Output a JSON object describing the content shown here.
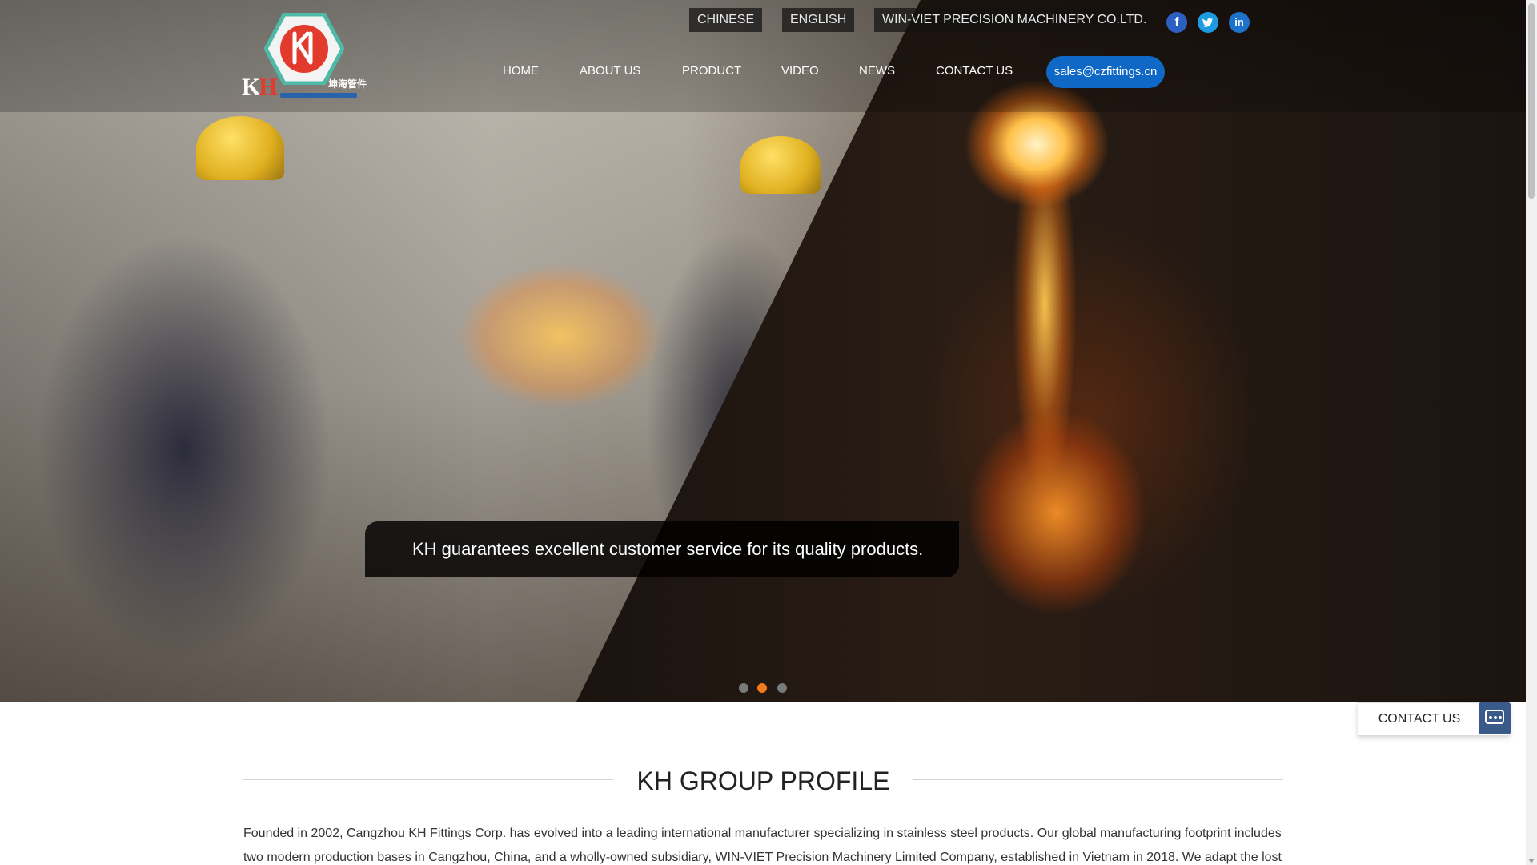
{
  "top_bar": {
    "lang_chinese": "CHINESE",
    "lang_english": "ENGLISH",
    "subsidiary": "WIN-VIET PRECISION MACHINERY CO.LTD."
  },
  "social": {
    "facebook_glyph": "f",
    "twitter_glyph": "🐦",
    "linkedin_glyph": "in",
    "icons": [
      "facebook-icon",
      "twitter-icon",
      "linkedin-icon"
    ]
  },
  "logo": {
    "letters_k": "K",
    "letters_h": "H",
    "chinese": "坤海管件"
  },
  "nav": {
    "home": "HOME",
    "about": "ABOUT US",
    "product": "PRODUCT",
    "video": "VIDEO",
    "news": "NEWS",
    "contact": "CONTACT US"
  },
  "email": "sales@czfittings.cn",
  "hero": {
    "caption": "KH guarantees excellent customer service for its quality products.",
    "active_slide": 2,
    "slide_count": 3
  },
  "profile": {
    "title": "KH GROUP PROFILE",
    "paragraph": "Founded in 2002, Cangzhou KH Fittings Corp. has evolved into a leading international manufacturer specializing in stainless steel products. Our global manufacturing footprint includes two modern production bases in Cangzhou, China, and a wholly-owned subsidiary, WIN-VIET Precision Machinery Limited Company, established in Vietnam in 2018. We adapt the lost"
  },
  "contact_widget": {
    "label": "CONTACT US",
    "icon": "chat-icon"
  },
  "colors": {
    "accent_blue": "#0f68c6",
    "active_dot": "#f07c1d",
    "logo_red": "#e23b2e"
  }
}
